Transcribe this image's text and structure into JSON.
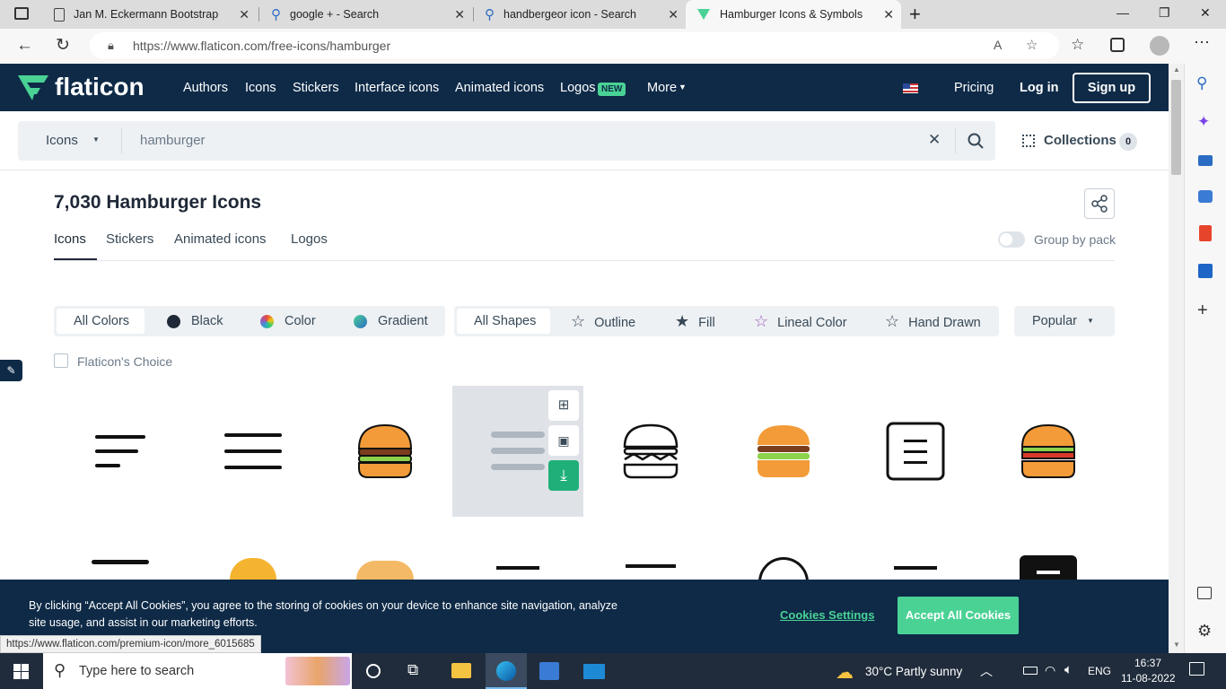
{
  "browser": {
    "tabs": [
      {
        "title": "Jan M. Eckermann Bootstrap",
        "active": false
      },
      {
        "title": "google + - Search",
        "active": false
      },
      {
        "title": "handbergeor icon - Search",
        "active": false
      },
      {
        "title": "Hamburger Icons & Symbols",
        "active": true
      }
    ],
    "url": "https://www.flaticon.com/free-icons/hamburger",
    "status_url": "https://www.flaticon.com/premium-icon/more_6015685"
  },
  "site": {
    "logo": "flaticon",
    "nav": [
      "Authors",
      "Icons",
      "Stickers",
      "Interface icons",
      "Animated icons",
      "Logos",
      "More"
    ],
    "new_badge": "NEW",
    "pricing": "Pricing",
    "login": "Log in",
    "signup": "Sign up"
  },
  "search": {
    "category": "Icons",
    "query": "hamburger",
    "collections_label": "Collections",
    "collections_count": "0"
  },
  "results": {
    "title": "7,030 Hamburger Icons",
    "tabs": [
      "Icons",
      "Stickers",
      "Animated icons",
      "Logos"
    ],
    "group_by_pack": "Group by pack",
    "colors": [
      "All Colors",
      "Black",
      "Color",
      "Gradient"
    ],
    "shapes": [
      "All Shapes",
      "Outline",
      "Fill",
      "Lineal Color",
      "Hand Drawn"
    ],
    "sort": "Popular",
    "flaticon_choice": "Flaticon's Choice"
  },
  "cookie": {
    "text_line1": "By clicking “Accept All Cookies”, you agree to the storing of cookies on your device to enhance site navigation, analyze",
    "text_line2": "site usage, and assist in our marketing efforts.",
    "settings": "Cookies Settings",
    "accept": "Accept All Cookies"
  },
  "taskbar": {
    "search_placeholder": "Type here to search",
    "weather": "30°C  Partly sunny",
    "lang": "ENG",
    "time": "16:37",
    "date": "11-08-2022"
  },
  "colors": {
    "brand_dark": "#0e2a47",
    "accent_green": "#4ad295"
  }
}
